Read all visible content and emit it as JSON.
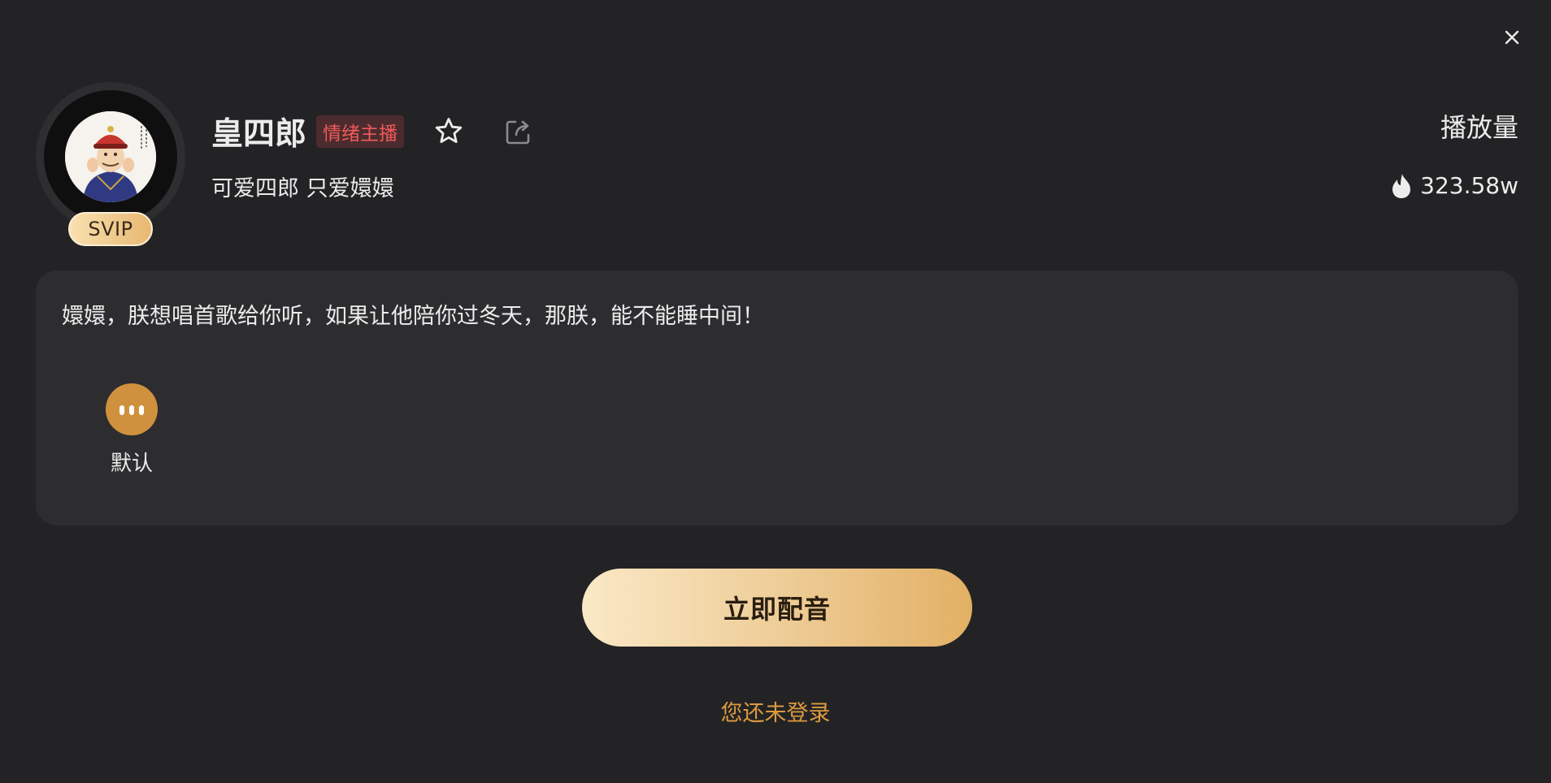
{
  "header": {
    "close_icon": "close-icon",
    "name": "皇四郎",
    "tag": "情绪主播",
    "subtitle": "可爱四郎 只爱嬛嬛",
    "badge": "SVIP",
    "favorite_icon": "star-outline-icon",
    "share_icon": "share-icon"
  },
  "stats": {
    "label": "播放量",
    "value": "323.58w",
    "icon": "flame-icon"
  },
  "card": {
    "quote": "嬛嬛，朕想唱首歌给你听，如果让他陪你过冬天，那朕，能不能睡中间！",
    "voices": [
      {
        "label": "默认",
        "icon": "audio-bars-icon",
        "selected": true
      }
    ]
  },
  "actions": {
    "primary_label": "立即配音",
    "login_hint": "您还未登录"
  },
  "colors": {
    "background": "#232325",
    "card": "#2d2d30",
    "accent_gold": "#e2b064",
    "link_orange": "#dc9a3e",
    "tag_red": "#f05a5a"
  }
}
